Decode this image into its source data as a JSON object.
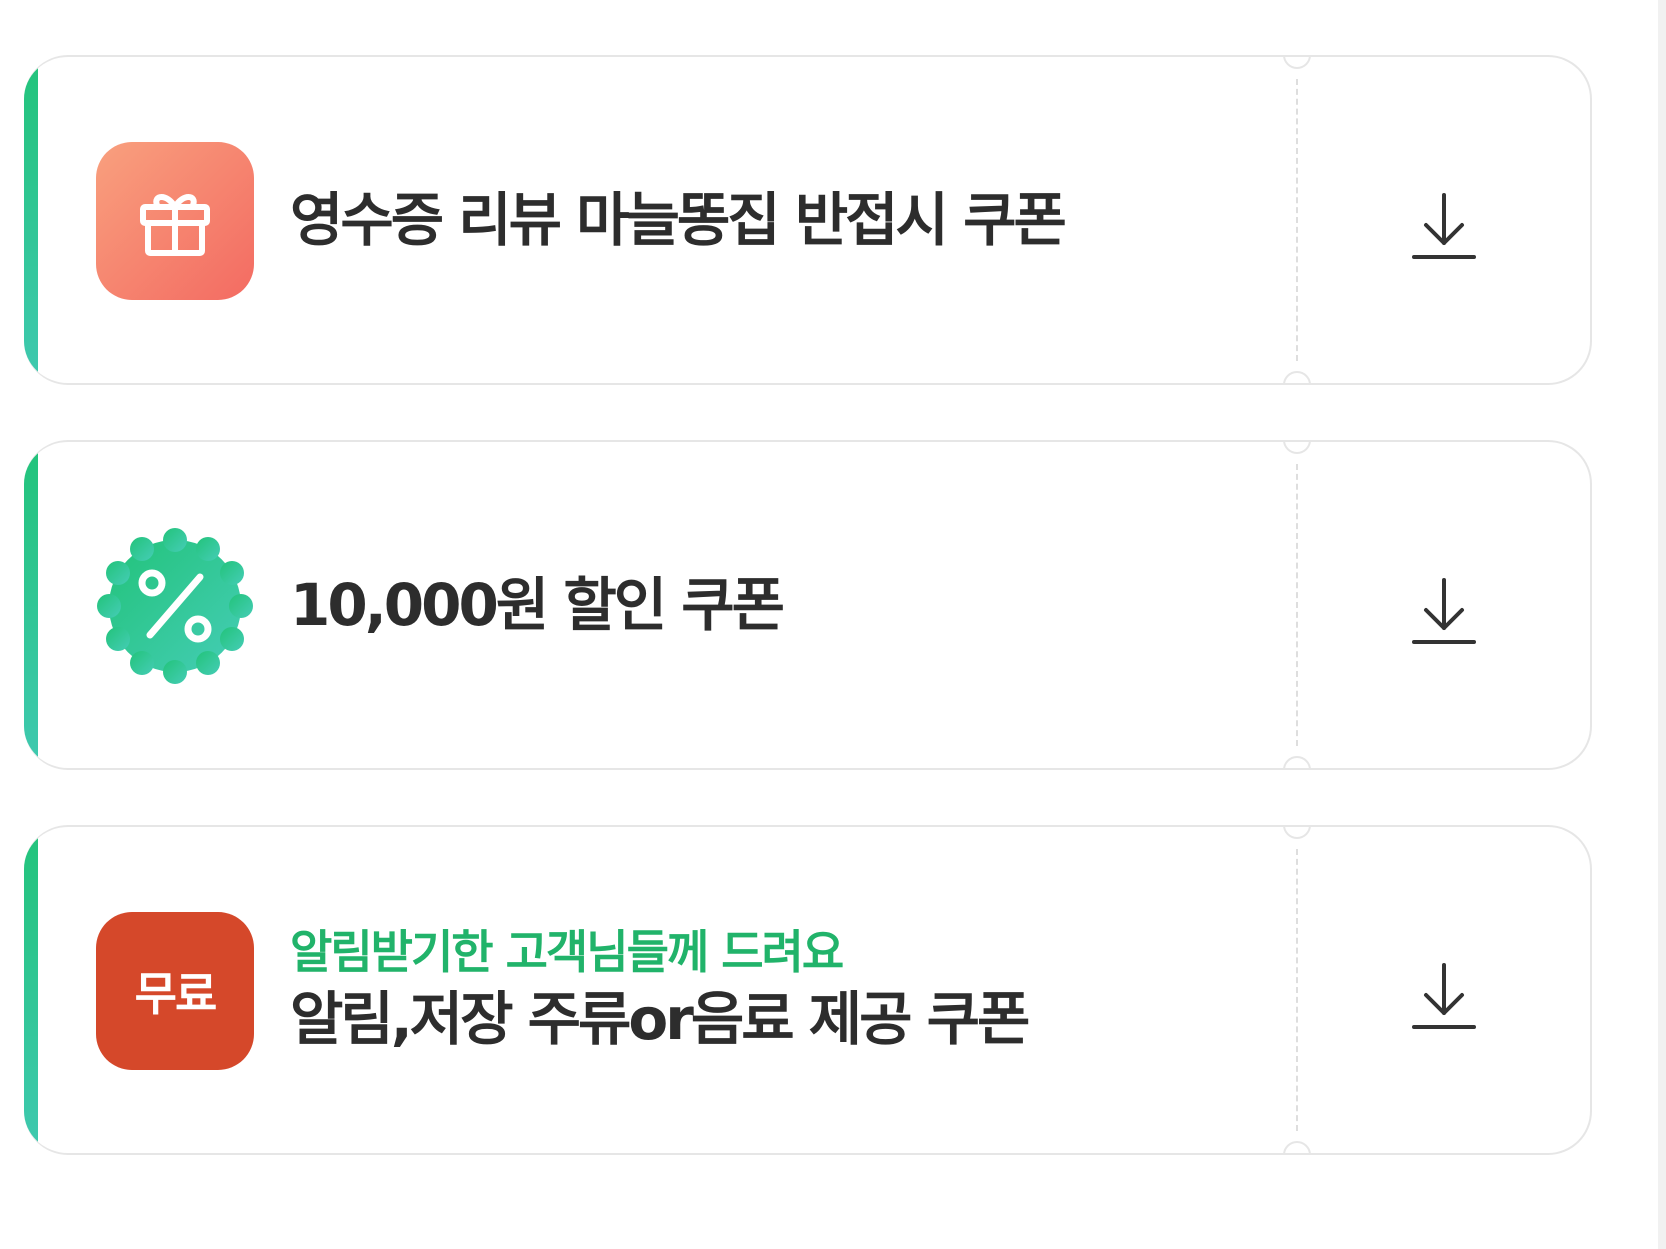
{
  "coupons": [
    {
      "icon": "gift-icon",
      "subtitle": "",
      "title": "영수증 리뷰 마늘똥집 반접시 쿠폰",
      "action": "download-icon"
    },
    {
      "icon": "percent-badge-icon",
      "subtitle": "",
      "title": "10,000원 할인 쿠폰",
      "action": "download-icon"
    },
    {
      "icon": "free-badge-icon",
      "icon_label": "무료",
      "subtitle": "알림받기한 고객님들께 드려요",
      "title": "알림,저장 주류or음료 제공 쿠폰",
      "action": "download-icon"
    }
  ],
  "colors": {
    "accent_green": "#22c37a",
    "gift_gradient_start": "#f9a07e",
    "gift_gradient_end": "#f36b62",
    "percent_badge": "#2fcc8e",
    "free_badge": "#d5482a",
    "title_text": "#2d2d2d",
    "subtitle_text": "#21b36a",
    "border": "#e6e6e6"
  }
}
